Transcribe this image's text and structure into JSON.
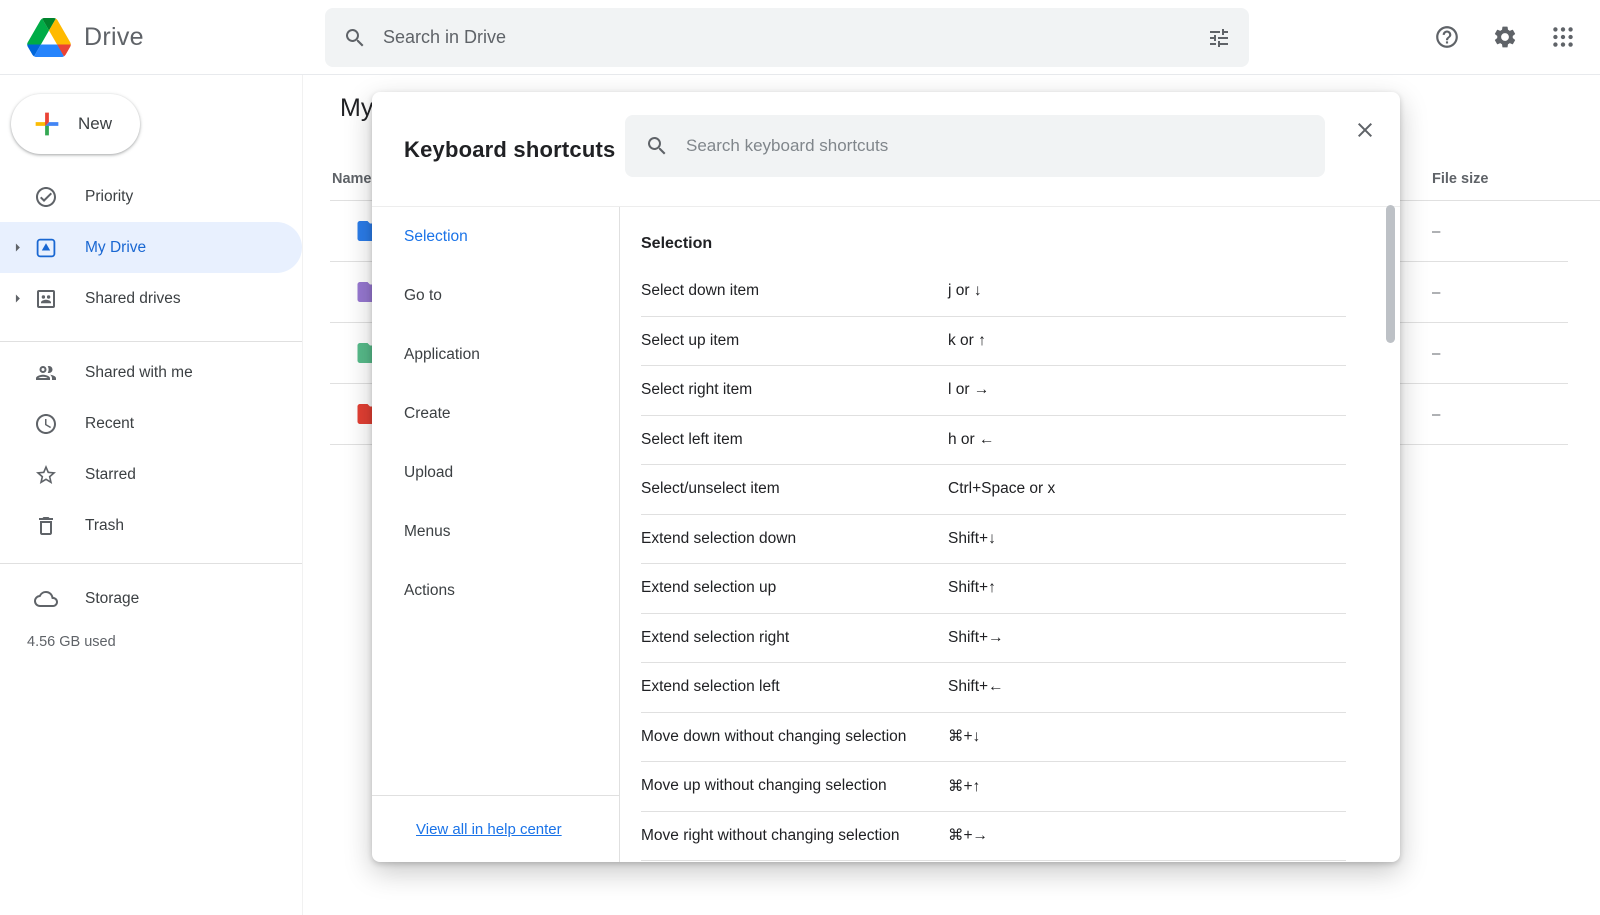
{
  "colors": {
    "accent_blue": "#1a73e8",
    "active_item_bg": "#e8f0fe",
    "active_item_text": "#1967d2"
  },
  "header": {
    "app_name": "Drive",
    "search_placeholder": "Search in Drive"
  },
  "sidebar": {
    "new_label": "New",
    "items": {
      "priority": "Priority",
      "my_drive": "My Drive",
      "shared_drives": "Shared drives",
      "shared_with_me": "Shared with me",
      "recent": "Recent",
      "starred": "Starred",
      "trash": "Trash",
      "storage": "Storage"
    },
    "storage_used": "4.56 GB used"
  },
  "content": {
    "page_title": "My",
    "columns": {
      "name": "Name",
      "file_size": "File size"
    },
    "rows": [
      {
        "folder_color": "#2b7ce9",
        "size": "–"
      },
      {
        "folder_color": "#9778d1",
        "size": "–"
      },
      {
        "folder_color": "#57bb8a",
        "size": "–"
      },
      {
        "folder_color": "#e23f33",
        "size": "–"
      }
    ]
  },
  "modal": {
    "title": "Keyboard shortcuts",
    "search_placeholder": "Search keyboard shortcuts",
    "nav_items": [
      {
        "label": "Selection",
        "active": true
      },
      {
        "label": "Go to",
        "active": false
      },
      {
        "label": "Application",
        "active": false
      },
      {
        "label": "Create",
        "active": false
      },
      {
        "label": "Upload",
        "active": false
      },
      {
        "label": "Menus",
        "active": false
      },
      {
        "label": "Actions",
        "active": false
      }
    ],
    "help_link": "View all in help center",
    "section_title": "Selection",
    "shortcuts": [
      {
        "action": "Select down item",
        "keys": "j or ↓"
      },
      {
        "action": "Select up item",
        "keys": "k or ↑"
      },
      {
        "action": "Select right item",
        "keys": "l or →"
      },
      {
        "action": "Select left item",
        "keys": "h or ←"
      },
      {
        "action": "Select/unselect item",
        "keys": "Ctrl+Space or x"
      },
      {
        "action": "Extend selection down",
        "keys": "Shift+↓"
      },
      {
        "action": "Extend selection up",
        "keys": "Shift+↑"
      },
      {
        "action": "Extend selection right",
        "keys": "Shift+→"
      },
      {
        "action": "Extend selection left",
        "keys": "Shift+←"
      },
      {
        "action": "Move down without changing selection",
        "keys": "⌘+↓"
      },
      {
        "action": "Move up without changing selection",
        "keys": "⌘+↑"
      },
      {
        "action": "Move right without changing selection",
        "keys": "⌘+→"
      }
    ]
  }
}
